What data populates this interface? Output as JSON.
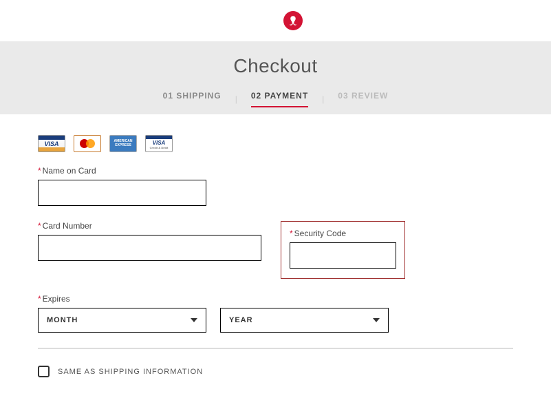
{
  "brand_color": "#d31334",
  "page_title": "Checkout",
  "steps": {
    "s1": "01 SHIPPING",
    "s2": "02 PAYMENT",
    "s3": "03 REVIEW"
  },
  "card_icons": {
    "visa": "VISA",
    "mastercard": "mastercard",
    "amex": "AMERICAN EXPRESS",
    "visa_debit_v": "VISA",
    "visa_debit_d": "Credit & Debit"
  },
  "labels": {
    "name_on_card": "Name on Card",
    "card_number": "Card Number",
    "security_code": "Security Code",
    "expires": "Expires"
  },
  "selects": {
    "month": "MONTH",
    "year": "YEAR"
  },
  "values": {
    "name_on_card": "",
    "card_number": "",
    "security_code": ""
  },
  "same_as_shipping": "SAME AS SHIPPING INFORMATION"
}
